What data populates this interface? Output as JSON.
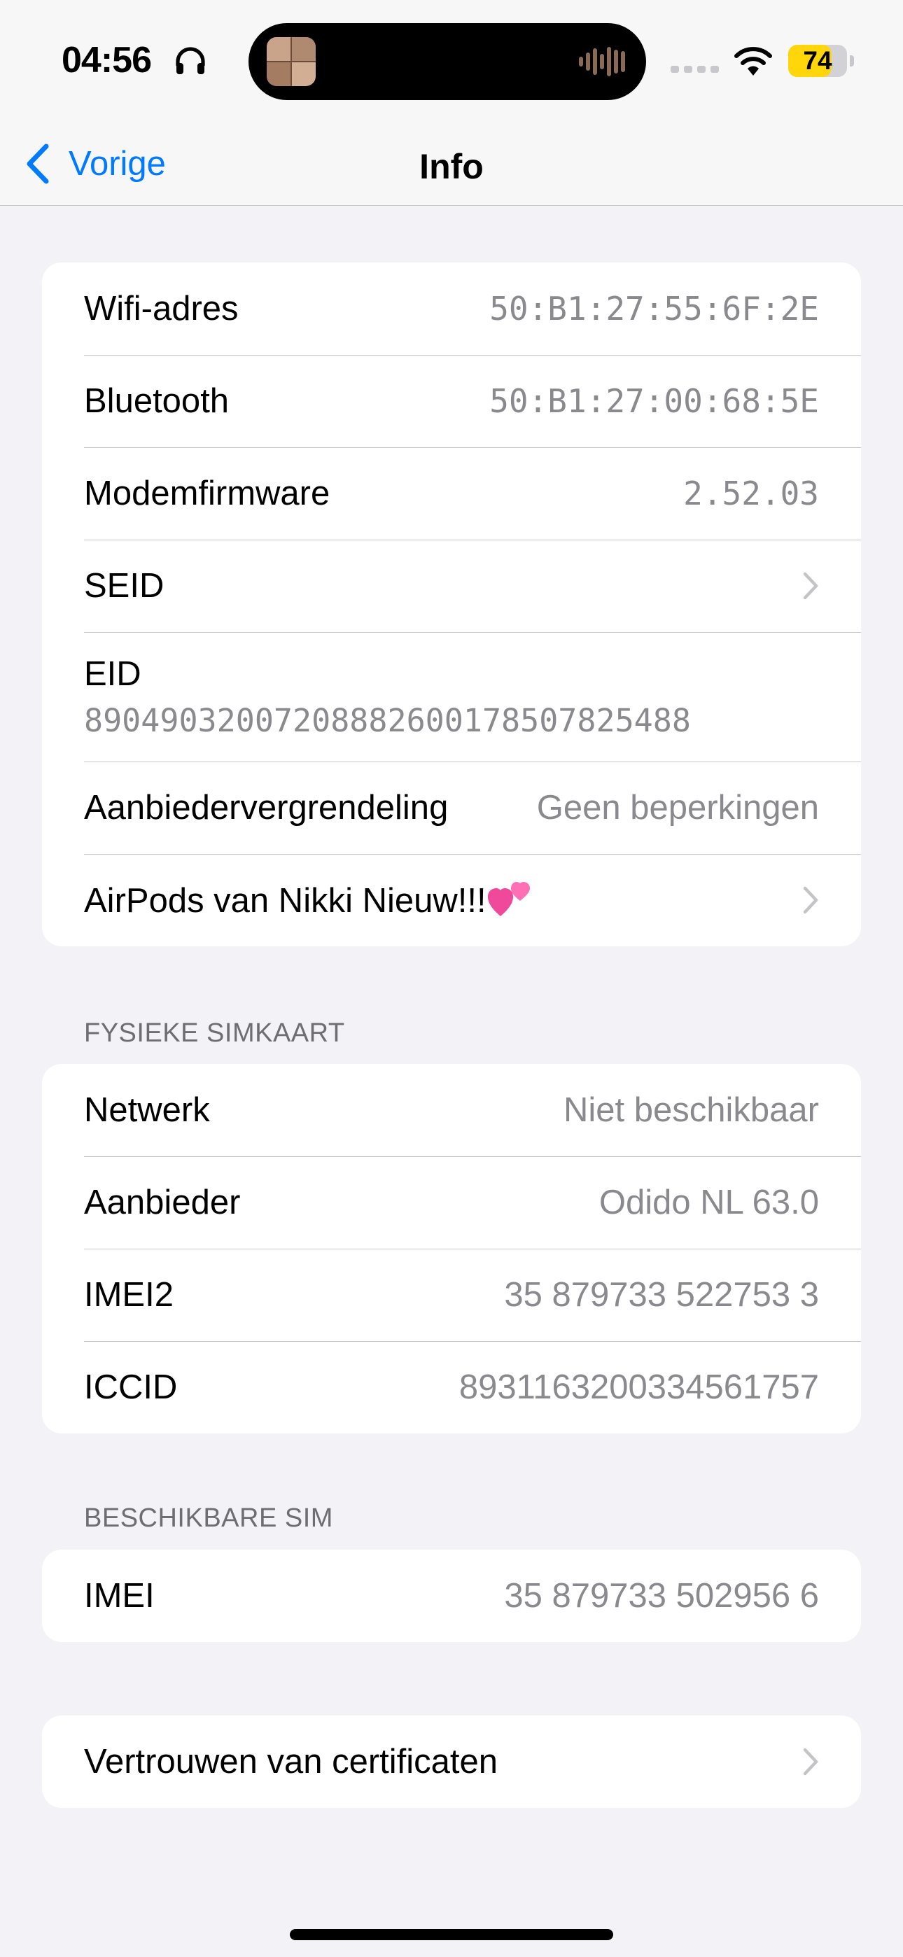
{
  "status_bar": {
    "time": "04:56",
    "battery_percent": "74",
    "battery_level": 0.74,
    "icons": [
      "headphones-icon",
      "waveform-icon",
      "cell-signal-icon",
      "wifi-icon",
      "battery-icon"
    ],
    "battery_color": "#ffd60a"
  },
  "nav": {
    "back_label": "Vorige",
    "title": "Info",
    "accent_color": "#007aff"
  },
  "group1": {
    "wifi": {
      "label": "Wifi-adres",
      "value": "50:B1:27:55:6F:2E"
    },
    "bluetooth": {
      "label": "Bluetooth",
      "value": "50:B1:27:00:68:5E"
    },
    "modem": {
      "label": "Modemfirmware",
      "value": "2.52.03"
    },
    "seid": {
      "label": "SEID"
    },
    "eid": {
      "label": "EID",
      "value": "89049032007208882600178507825488"
    },
    "carrier_lock": {
      "label": "Aanbiedervergrendeling",
      "value": "Geen beperkingen"
    },
    "airpods": {
      "label": "AirPods van Nikki Nieuw!!!"
    }
  },
  "physical_sim": {
    "header": "FYSIEKE SIMKAART",
    "network": {
      "label": "Netwerk",
      "value": "Niet beschikbaar"
    },
    "carrier": {
      "label": "Aanbieder",
      "value": "Odido NL 63.0"
    },
    "imei2": {
      "label": "IMEI2",
      "value": "35 879733 522753 3"
    },
    "iccid": {
      "label": "ICCID",
      "value": "8931163200334561757"
    }
  },
  "available_sim": {
    "header": "BESCHIKBARE SIM",
    "imei": {
      "label": "IMEI",
      "value": "35 879733 502956 6"
    }
  },
  "certificates": {
    "label": "Vertrouwen van certificaten"
  }
}
